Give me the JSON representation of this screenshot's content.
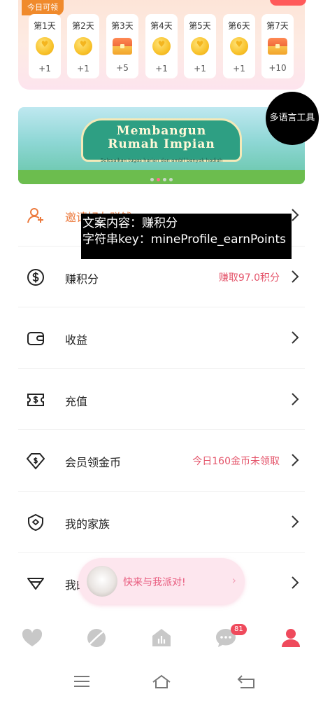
{
  "checkin": {
    "today_tag": "今日可领",
    "days": [
      {
        "label": "第1天",
        "reward": "+1",
        "icon": "coin-icon"
      },
      {
        "label": "第2天",
        "reward": "+1",
        "icon": "coin-icon"
      },
      {
        "label": "第3天",
        "reward": "+5",
        "icon": "chest-icon"
      },
      {
        "label": "第4天",
        "reward": "+1",
        "icon": "coin-icon"
      },
      {
        "label": "第5天",
        "reward": "+1",
        "icon": "coin-icon"
      },
      {
        "label": "第6天",
        "reward": "+1",
        "icon": "coin-icon"
      },
      {
        "label": "第7天",
        "reward": "+10",
        "icon": "chest-icon"
      }
    ]
  },
  "banner": {
    "title_line1": "Membangun",
    "title_line2": "Rumah Impian",
    "subtitle": "Selesaikan tugas harian dan ambil banyak hadiah"
  },
  "lang_tool": {
    "label": "多语言工具"
  },
  "tooltip": {
    "line1": "文案内容：赚积分",
    "line2": "字符串key：mineProfile_earnPoints"
  },
  "menu": [
    {
      "label": "邀请好友赚钱",
      "value": "",
      "icon": "invite-friend-icon",
      "accent": true
    },
    {
      "label": "赚积分",
      "value": "赚取97.0积分",
      "icon": "dollar-circle-icon"
    },
    {
      "label": "收益",
      "value": "",
      "icon": "wallet-icon"
    },
    {
      "label": "充值",
      "value": "",
      "icon": "recharge-ticket-icon"
    },
    {
      "label": "会员领金币",
      "value": "今日160金币未领取",
      "icon": "vip-diamond-dollar-icon"
    },
    {
      "label": "我的家族",
      "value": "",
      "icon": "family-shield-icon"
    },
    {
      "label": "我的",
      "value": "",
      "icon": "diamond-icon"
    }
  ],
  "party": {
    "text": "快来与我派对!"
  },
  "tabs": {
    "items": [
      "heart-icon",
      "planet-icon",
      "live-house-icon",
      "chat-icon",
      "profile-icon"
    ],
    "message_badge": "81"
  },
  "colors": {
    "accent_pink": "#e4546a",
    "accent_orange": "#ec7a3d",
    "active_tab": "#ef4a5c",
    "inactive_tab": "#c8c8c8"
  }
}
